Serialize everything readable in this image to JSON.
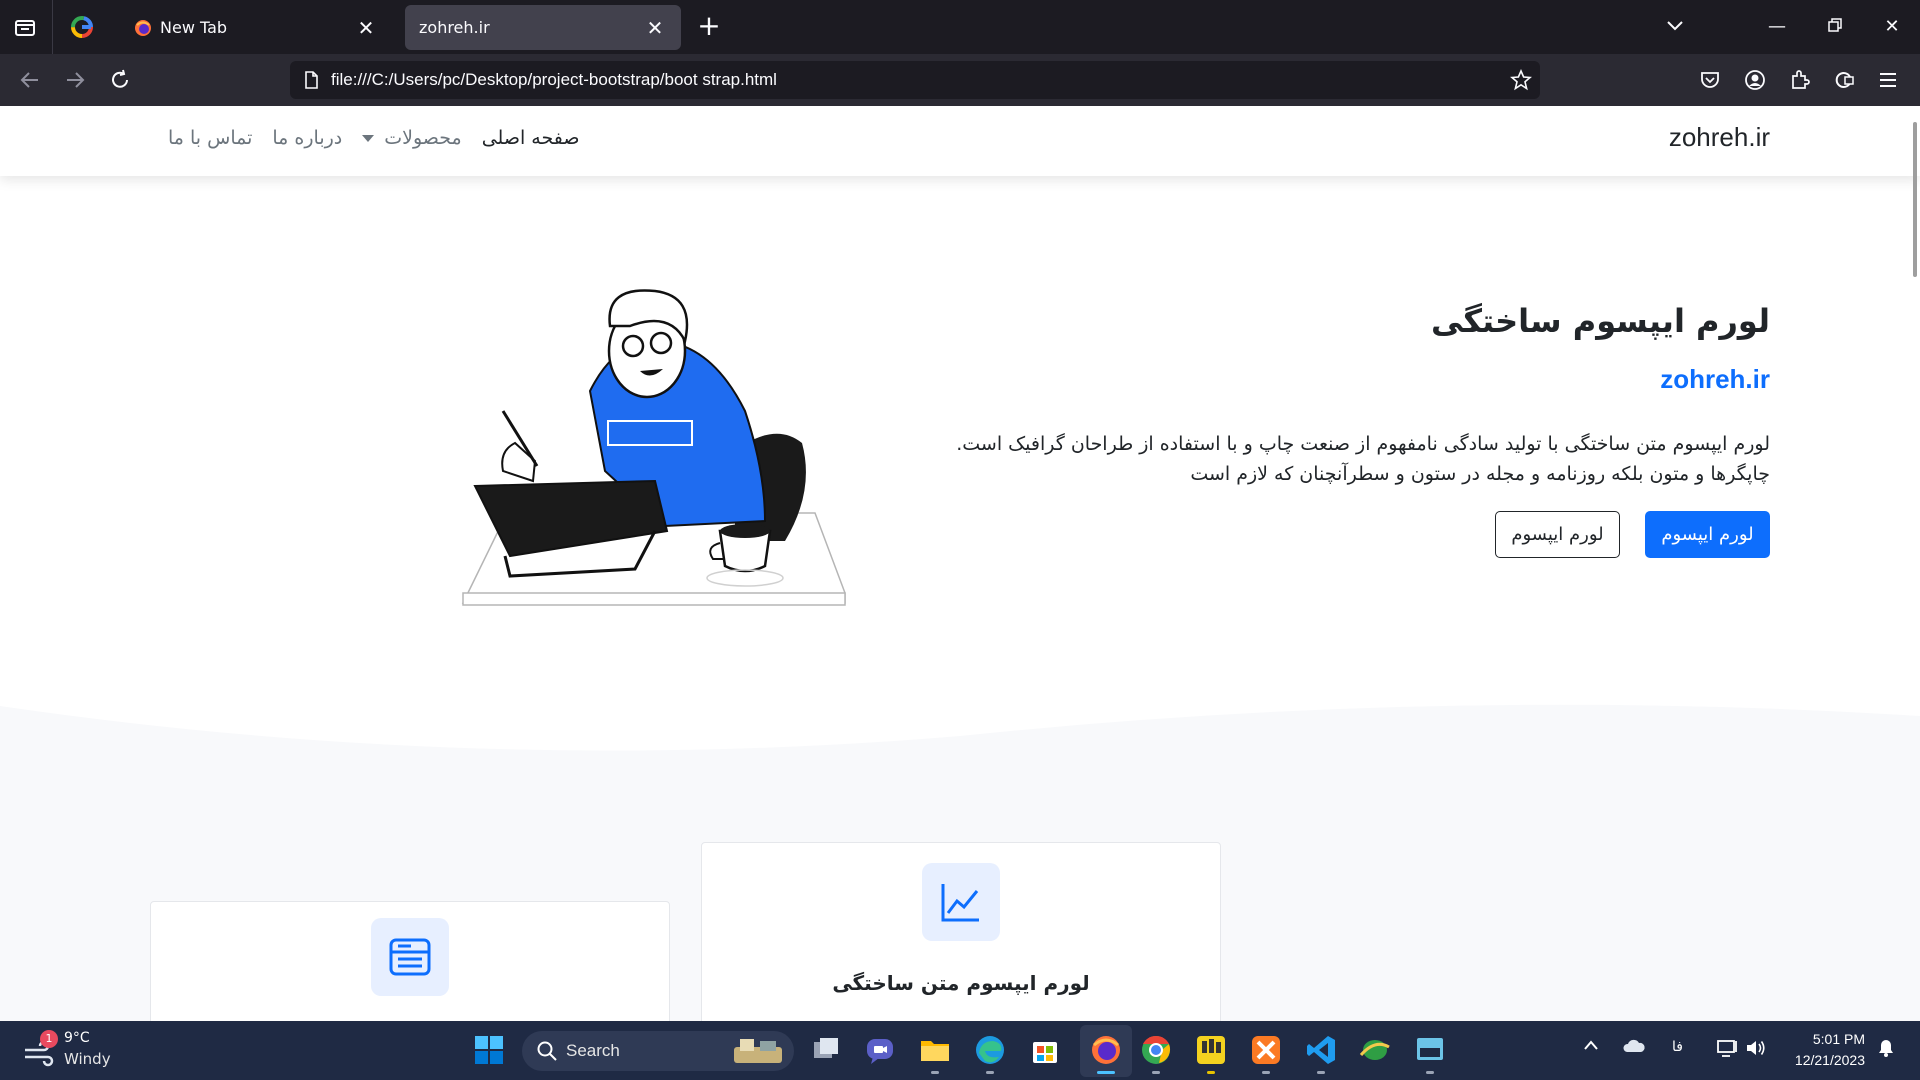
{
  "browser": {
    "tabs": [
      {
        "title": "New Tab",
        "active": false
      },
      {
        "title": "zohreh.ir",
        "active": true
      }
    ],
    "url": "file:///C:/Users/pc/Desktop/project-bootstrap/boot strap.html"
  },
  "site": {
    "brand": "zohreh.ir",
    "menu": {
      "home": "صفحه اصلی",
      "products": "محصولات",
      "about": "درباره ما",
      "contact": "تماس با ما"
    },
    "hero": {
      "title": "لورم ایپسوم ساختگی",
      "subtitle": "zohreh.ir",
      "text_line1": "لورم ایپسوم متن ساختگی با تولید سادگی نامفهوم از صنعت چاپ و با استفاده از طراحان گرافیک است.",
      "text_line2": "چاپگرها و متون بلکه روزنامه و مجله در ستون و سطرآنچنان که لازم است",
      "primary_button": "لورم ایپسوم",
      "secondary_button": "لورم ایپسوم"
    },
    "cards": [
      {
        "icon": "server-list-icon",
        "title": ""
      },
      {
        "icon": "line-chart-icon",
        "title": "لورم ایپسوم متن ساختگی"
      }
    ],
    "accent_color": "#0d6efd"
  },
  "taskbar": {
    "weather": {
      "temp": "9°C",
      "condition": "Windy",
      "badge": "1"
    },
    "search_label": "Search",
    "language": "فا",
    "time": "5:01 PM",
    "date": "12/21/2023"
  }
}
